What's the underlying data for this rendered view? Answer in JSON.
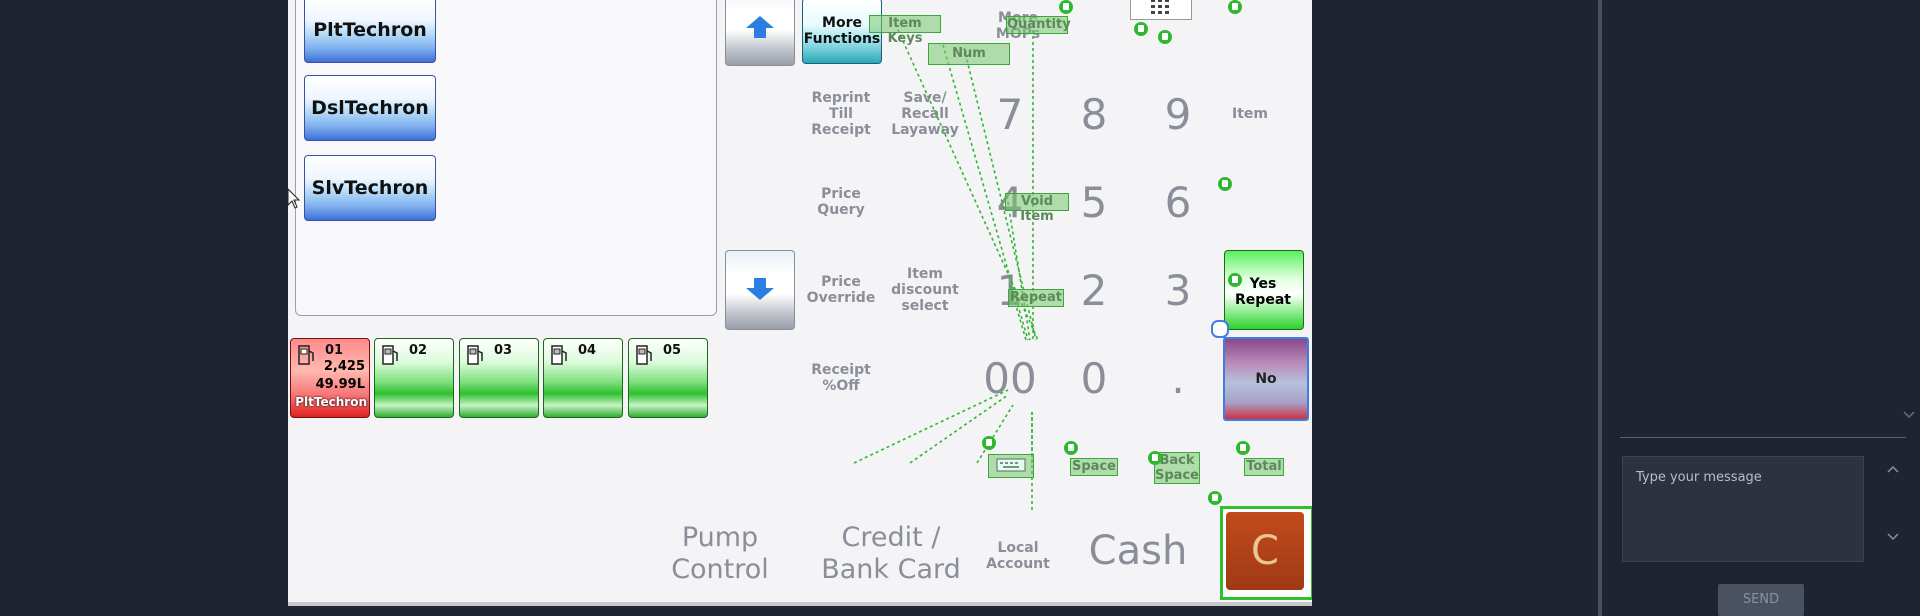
{
  "grades": [
    "PltTechron",
    "DslTechron",
    "SlvTechron"
  ],
  "more_functions": "More\nFunctions",
  "more_mops": "More\nMOPs",
  "func_labels": {
    "reprint": "Reprint\nTill\nReceipt",
    "save_recall": "Save/\nRecall\nLayaway",
    "price_query": "Price\nQuery",
    "price_override": "Price\nOverride",
    "item_discount": "Item\ndiscount\nselect",
    "receipt_off": "Receipt\n%Off",
    "item": "Item"
  },
  "digits": {
    "d7": "7",
    "d8": "8",
    "d9": "9",
    "d4": "4",
    "d5": "5",
    "d6": "6",
    "d1": "1",
    "d2": "2",
    "d3": "3",
    "d00": "00",
    "d0": "0",
    "dot": "."
  },
  "buttons": {
    "yes_repeat": "Yes\nRepeat",
    "no": "No",
    "clear": "C"
  },
  "pumps": [
    {
      "num": "01",
      "amount": "2,425",
      "volume": "49.99L",
      "grade": "PltTechron",
      "status": "red"
    },
    {
      "num": "02"
    },
    {
      "num": "03"
    },
    {
      "num": "04"
    },
    {
      "num": "05"
    }
  ],
  "mop": {
    "pump_control": "Pump\nControl",
    "credit": "Credit /\nBank Card",
    "local": "Local\nAccount",
    "cash": "Cash"
  },
  "annotations": {
    "item_keys": "Item Keys",
    "num": "Num",
    "quantity": "Quantity",
    "void_item": "Void Item",
    "repeat": "Repeat",
    "space": "Space",
    "back_space": "Back\nSpace",
    "total": "Total"
  },
  "chat": {
    "placeholder": "Type your message",
    "send": "SEND"
  },
  "colors": {
    "annotation_green": "#3aa83a",
    "pump_active": "#2fbf2f",
    "pump_alert": "#e02222",
    "clear_button": "#a8401a"
  }
}
